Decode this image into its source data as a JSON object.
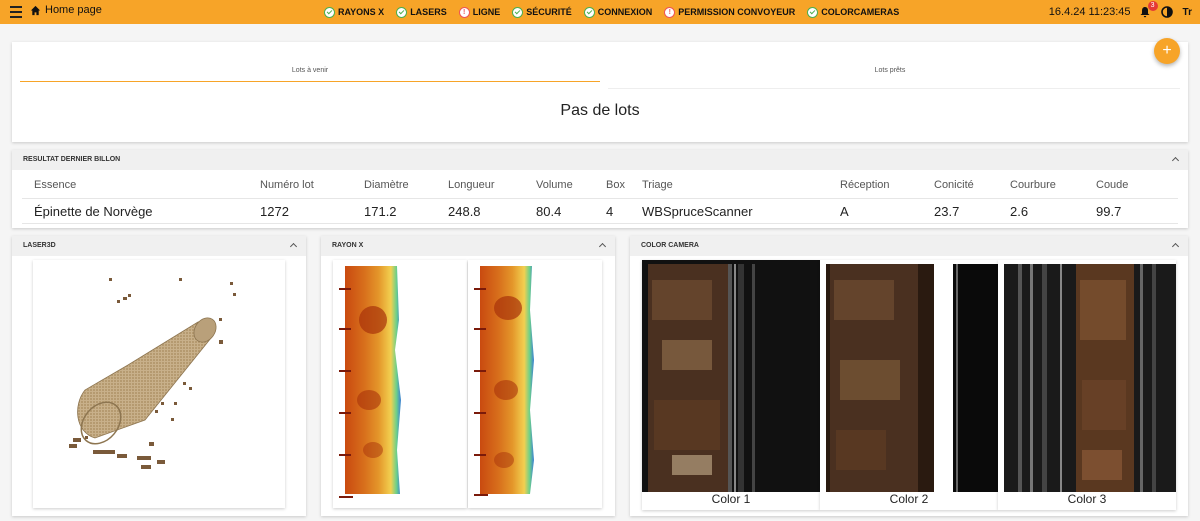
{
  "topbar": {
    "home_label": "Home page",
    "status_items": [
      {
        "label": "RAYONS X",
        "state": "ok"
      },
      {
        "label": "LASERS",
        "state": "ok"
      },
      {
        "label": "LIGNE",
        "state": "warn"
      },
      {
        "label": "SÉCURITÉ",
        "state": "ok"
      },
      {
        "label": "CONNEXION",
        "state": "ok"
      },
      {
        "label": "PERMISSION CONVOYEUR",
        "state": "warn"
      },
      {
        "label": "COLORCAMERAS",
        "state": "ok"
      }
    ],
    "datetime": "16.4.24 11:23:45",
    "notification_count": "3",
    "language": "Tr"
  },
  "colors": {
    "accent": "#f7a428",
    "ok": "#4caf50",
    "warn": "#e55555",
    "badge": "#e53935"
  },
  "lots": {
    "tabs": [
      {
        "label": "Lots à venir"
      },
      {
        "label": "Lots prêts"
      }
    ],
    "empty_message": "Pas de lots",
    "fab_label": "+"
  },
  "result": {
    "title": "RESULTAT DERNIER BILLON",
    "headers": [
      "Essence",
      "Numéro lot",
      "Diamètre",
      "Longueur",
      "Volume",
      "Box",
      "Triage",
      "Réception",
      "Conicité",
      "Courbure",
      "Coude"
    ],
    "values": [
      "Épinette de Norvège",
      "1272",
      "171.2",
      "248.8",
      "80.4",
      "4",
      "WBSpruceScanner",
      "A",
      "23.7",
      "2.6",
      "99.7"
    ]
  },
  "laser": {
    "title": "LASER3D"
  },
  "xray": {
    "title": "RAYON X"
  },
  "color_camera": {
    "title": "COLOR CAMERA",
    "labels": [
      "Color 1",
      "Color 2",
      "Color 3"
    ]
  }
}
